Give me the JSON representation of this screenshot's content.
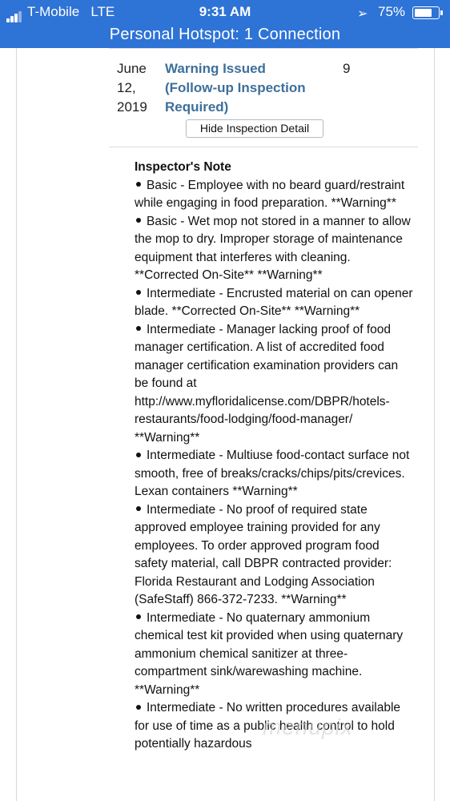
{
  "status_bar": {
    "carrier": "T-Mobile",
    "network": "LTE",
    "time": "9:31 AM",
    "battery_percent": "75%",
    "battery_level": 0.75,
    "hotspot_banner": "Personal Hotspot: 1 Connection",
    "colors": {
      "banner": "#2e73d6"
    }
  },
  "inspection": {
    "date_lines": [
      "June",
      "12,",
      "2019"
    ],
    "status_lines": [
      "Warning Issued",
      "(Follow-up Inspection",
      "Required)"
    ],
    "violation_count": "9",
    "hide_detail_label": "Hide Inspection Detail",
    "status_color": "#3d6f9a"
  },
  "inspector_note": {
    "title": "Inspector's Note",
    "items": [
      "Basic - Employee with no beard guard/restraint while engaging in food preparation. **Warning**",
      "Basic - Wet mop not stored in a manner to allow the mop to dry. Improper storage of maintenance equipment that interferes with cleaning. **Corrected On-Site** **Warning**",
      "Intermediate - Encrusted material on can opener blade. **Corrected On-Site** **Warning**",
      "Intermediate - Manager lacking proof of food manager certification. A list of accredited food manager certification examination providers can be found at http://www.myfloridalicense.com/DBPR/hotels-restaurants/food-lodging/food-manager/ **Warning**",
      "Intermediate - Multiuse food-contact surface not smooth, free of breaks/cracks/chips/pits/crevices. Lexan containers **Warning**",
      "Intermediate - No proof of required state approved employee training provided for any employees. To order approved program food safety material, call DBPR contracted provider: Florida Restaurant and Lodging Association (SafeStaff) 866-372-7233. **Warning**",
      "Intermediate - No quaternary ammonium chemical test kit provided when using quaternary ammonium chemical sanitizer at three-compartment sink/warewashing machine. **Warning**",
      "Intermediate - No written procedures available for use of time as a public health control to hold potentially hazardous"
    ]
  },
  "watermark": "menupix"
}
